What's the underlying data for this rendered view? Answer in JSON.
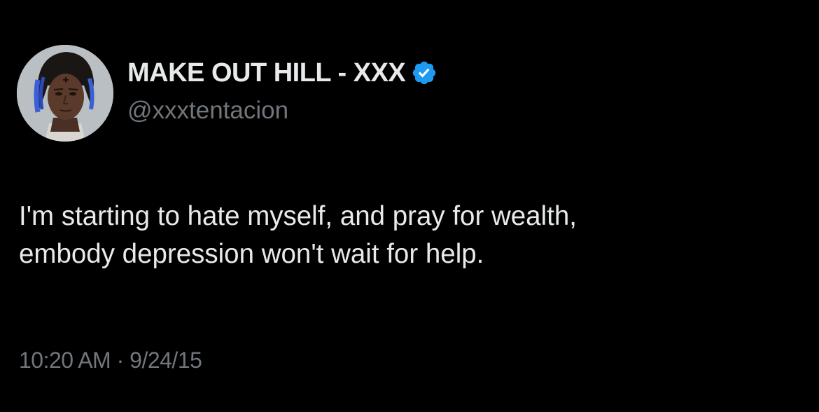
{
  "tweet": {
    "author": {
      "display_name": "MAKE OUT HILL - XXX",
      "handle": "@xxxtentacion",
      "verified_icon": "verified-badge-icon",
      "avatar": "avatar-photo"
    },
    "text_lines": [
      "I'm starting to hate myself, and pray for wealth,",
      "embody depression won't wait for help."
    ],
    "time": "10:20 AM",
    "separator": "·",
    "date": "9/24/15"
  },
  "colors": {
    "background": "#000000",
    "primary_text": "#e7e9ea",
    "secondary_text": "#71767b",
    "verified_blue": "#1d9bf0"
  }
}
